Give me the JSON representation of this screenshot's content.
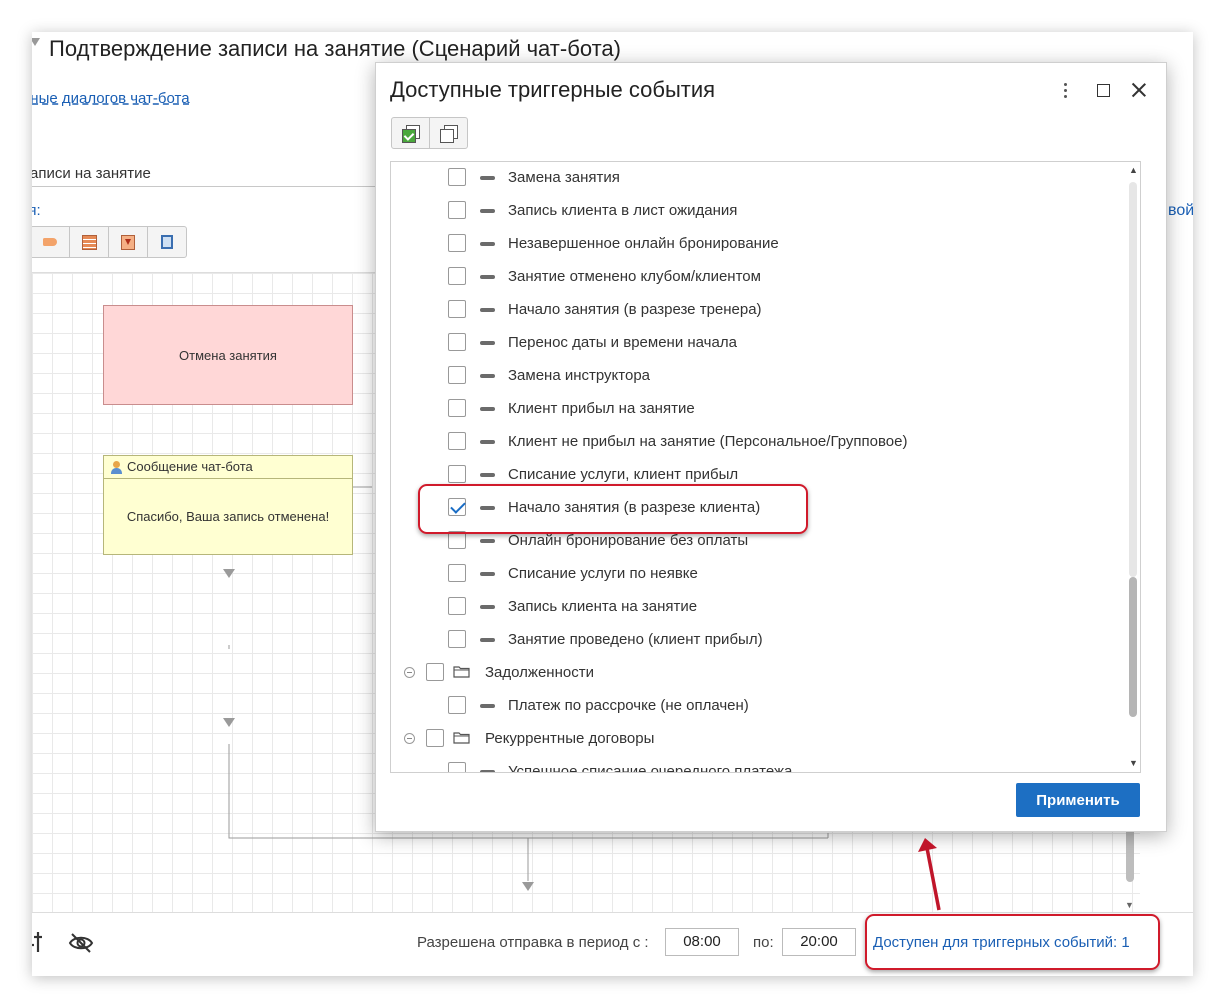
{
  "background_window": {
    "title": "Подтверждение записи на занятие (Сценарий чат-бота)",
    "link_text": "нные диалогов чат-бота",
    "label_1": ":",
    "field_value": "аписи на занятие",
    "label_2": "ия:",
    "right_clipped_text": "вой",
    "nodes": {
      "cancel_node": "Отмена занятия",
      "message_header": "Сообщение чат-бота",
      "message_body": "Спасибо, Ваша запись отменена!"
    },
    "bottom": {
      "period_label": "Разрешена отправка в период с :",
      "from_value": "08:00",
      "to_label": "по:",
      "to_value": "20:00",
      "trigger_link": "Доступен для триггерных событий: 1"
    }
  },
  "dialog": {
    "title": "Доступные триггерные события",
    "apply_label": "Применить",
    "rows": [
      {
        "type": "item",
        "label": "Замена занятия",
        "checked": false
      },
      {
        "type": "item",
        "label": "Запись клиента в лист ожидания",
        "checked": false
      },
      {
        "type": "item",
        "label": "Незавершенное онлайн бронирование",
        "checked": false
      },
      {
        "type": "item",
        "label": "Занятие отменено клубом/клиентом",
        "checked": false
      },
      {
        "type": "item",
        "label": "Начало занятия  (в разрезе тренера)",
        "checked": false
      },
      {
        "type": "item",
        "label": "Перенос даты и времени начала",
        "checked": false
      },
      {
        "type": "item",
        "label": "Замена инструктора",
        "checked": false
      },
      {
        "type": "item",
        "label": "Клиент прибыл на занятие",
        "checked": false
      },
      {
        "type": "item",
        "label": "Клиент не прибыл на занятие (Персональное/Групповое)",
        "checked": false
      },
      {
        "type": "item",
        "label": "Списание услуги, клиент прибыл",
        "checked": false
      },
      {
        "type": "item",
        "label": "Начало занятия  (в разрезе клиента)",
        "checked": true
      },
      {
        "type": "item",
        "label": "Онлайн бронирование без оплаты",
        "checked": false
      },
      {
        "type": "item",
        "label": "Списание услуги по неявке",
        "checked": false
      },
      {
        "type": "item",
        "label": "Запись клиента на занятие",
        "checked": false
      },
      {
        "type": "item",
        "label": "Занятие проведено (клиент прибыл)",
        "checked": false
      },
      {
        "type": "group",
        "label": "Задолженности",
        "checked": false
      },
      {
        "type": "item",
        "label": "Платеж по рассрочке (не оплачен)",
        "checked": false
      },
      {
        "type": "group",
        "label": "Рекуррентные договоры",
        "checked": false
      },
      {
        "type": "item",
        "label": "Успешное списание очередного платежа",
        "checked": false
      }
    ]
  },
  "colors": {
    "accent": "#1d6fc3",
    "link": "#1a5fb4",
    "annotation": "#d01a2b",
    "cancel_node_fill": "#ffd7d7",
    "message_node_fill": "#ffffd2"
  }
}
